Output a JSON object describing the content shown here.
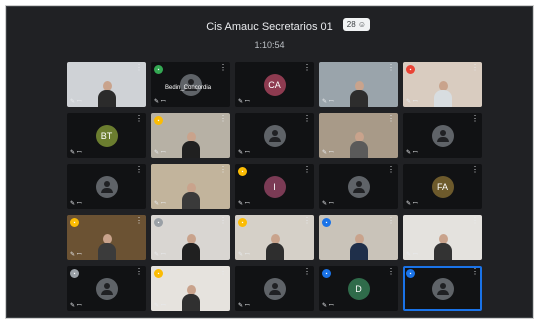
{
  "meeting": {
    "title": "Cis Amauc Secretarios 01",
    "participant_count": "28",
    "participant_icon": "people-icon",
    "elapsed": "1:10:54"
  },
  "mic_glyph": "✎ ꟷ",
  "more_glyph": "⋮",
  "tiles": [
    {
      "type": "video",
      "bg": "#cfd2d6",
      "body": "#2b2b2b",
      "indicator": null,
      "mic": true,
      "label": ""
    },
    {
      "type": "avatar",
      "color": "#4a4a4a",
      "initials": "",
      "indicator": "#34a853",
      "mic": true,
      "label": "Bedin_Concordia"
    },
    {
      "type": "avatar",
      "color": "#8e3b50",
      "initials": "CA",
      "indicator": null,
      "mic": true,
      "label": ""
    },
    {
      "type": "video",
      "bg": "#9aa4ab",
      "body": "#2d2d2d",
      "indicator": null,
      "mic": true,
      "label": ""
    },
    {
      "type": "video",
      "bg": "#d9ccc0",
      "body": "#d8dde0",
      "indicator": "#ea4335",
      "mic": true,
      "label": ""
    },
    {
      "type": "avatar",
      "color": "#6b7d2f",
      "initials": "BT",
      "indicator": null,
      "mic": true,
      "label": ""
    },
    {
      "type": "video",
      "bg": "#b7b1a5",
      "body": "#202020",
      "indicator": "#fbbc04",
      "mic": true,
      "label": ""
    },
    {
      "type": "avatar",
      "color": "#5f6368",
      "initials": "",
      "indicator": null,
      "mic": true,
      "label": ""
    },
    {
      "type": "video",
      "bg": "#a89a88",
      "body": "#5a5a5a",
      "indicator": null,
      "mic": true,
      "label": ""
    },
    {
      "type": "avatar",
      "color": "#5f6368",
      "initials": "",
      "indicator": null,
      "mic": true,
      "label": ""
    },
    {
      "type": "avatar",
      "color": "#5f6368",
      "initials": "",
      "indicator": null,
      "mic": true,
      "label": ""
    },
    {
      "type": "video",
      "bg": "#c2b49c",
      "body": "#3a3a3a",
      "indicator": null,
      "mic": true,
      "label": ""
    },
    {
      "type": "avatar",
      "color": "#7b3b55",
      "initials": "I",
      "indicator": "#fbbc04",
      "mic": true,
      "label": ""
    },
    {
      "type": "avatar",
      "color": "#5f6368",
      "initials": "",
      "indicator": null,
      "mic": true,
      "label": ""
    },
    {
      "type": "avatar",
      "color": "#6d5a2c",
      "initials": "FA",
      "indicator": null,
      "mic": true,
      "label": ""
    },
    {
      "type": "video",
      "bg": "#6b5233",
      "body": "#3b3b3b",
      "indicator": "#fbbc04",
      "mic": true,
      "label": ""
    },
    {
      "type": "video",
      "bg": "#d9d6d2",
      "body": "#202020",
      "indicator": "#9aa0a6",
      "mic": true,
      "label": ""
    },
    {
      "type": "video",
      "bg": "#d5d0c8",
      "body": "#2e2e2e",
      "indicator": "#fbbc04",
      "mic": true,
      "label": ""
    },
    {
      "type": "video",
      "bg": "#c9c3b9",
      "body": "#1f2f4a",
      "indicator": "#1a73e8",
      "mic": false,
      "label": ""
    },
    {
      "type": "video",
      "bg": "#e4e2de",
      "body": "#333333",
      "indicator": null,
      "mic": true,
      "label": ""
    },
    {
      "type": "avatar",
      "color": "#5f6368",
      "initials": "",
      "indicator": "#9aa0a6",
      "mic": true,
      "label": ""
    },
    {
      "type": "video",
      "bg": "#e6e3de",
      "body": "#303030",
      "indicator": "#fbbc04",
      "mic": true,
      "label": ""
    },
    {
      "type": "avatar",
      "color": "#5f6368",
      "initials": "",
      "indicator": null,
      "mic": true,
      "label": ""
    },
    {
      "type": "avatar",
      "color": "#2f6b4a",
      "initials": "D",
      "indicator": "#1a73e8",
      "mic": true,
      "label": ""
    },
    {
      "type": "avatar",
      "color": "#5f6368",
      "initials": "",
      "indicator": "#1a73e8",
      "mic": false,
      "label": "",
      "active": true
    }
  ]
}
